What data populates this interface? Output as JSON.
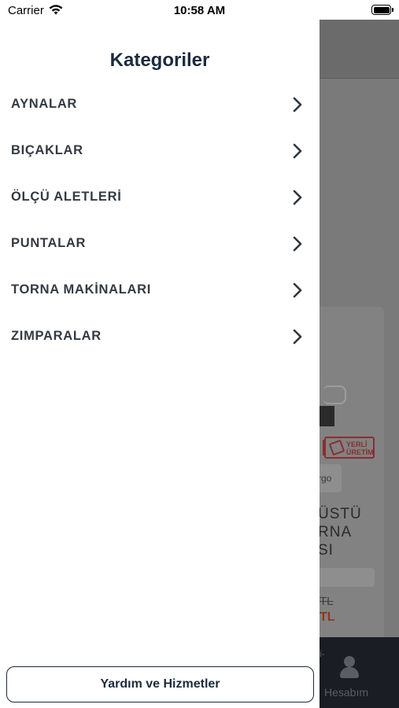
{
  "status_bar": {
    "carrier": "Carrier",
    "time": "10:58 AM",
    "wifi_icon": "wifi-icon",
    "battery_icon": "battery-icon"
  },
  "drawer": {
    "title": "Kategoriler",
    "categories": [
      {
        "label": "AYNALAR",
        "icon": "chevron-right-icon"
      },
      {
        "label": "BIÇAKLAR",
        "icon": "chevron-right-icon"
      },
      {
        "label": "ÖLÇÜ ALETLERİ",
        "icon": "chevron-right-icon"
      },
      {
        "label": "PUNTALAR",
        "icon": "chevron-right-icon"
      },
      {
        "label": "TORNA MAKİNALARI",
        "icon": "chevron-right-icon"
      },
      {
        "label": "ZIMPARALAR",
        "icon": "chevron-right-icon"
      }
    ],
    "help_button": "Yardım ve Hizmetler"
  },
  "background": {
    "badge_text": "YERLİ ÜRETİM",
    "cargo_text": "rgo",
    "product_title": "ÜSTÜ\nRNA\nSI",
    "old_price": "TL",
    "new_price": "TL",
    "tab_cut_label": "i-",
    "tab_label": "Hesabım",
    "tab_icon": "user-icon",
    "colors": {
      "overlay": "#7a7a7a",
      "tabbar": "#1a1e24",
      "badge": "#8a2e2e"
    }
  },
  "colors": {
    "title": "#1c2b3e",
    "category_text": "#333a42",
    "drawer_bg": "#ffffff"
  }
}
